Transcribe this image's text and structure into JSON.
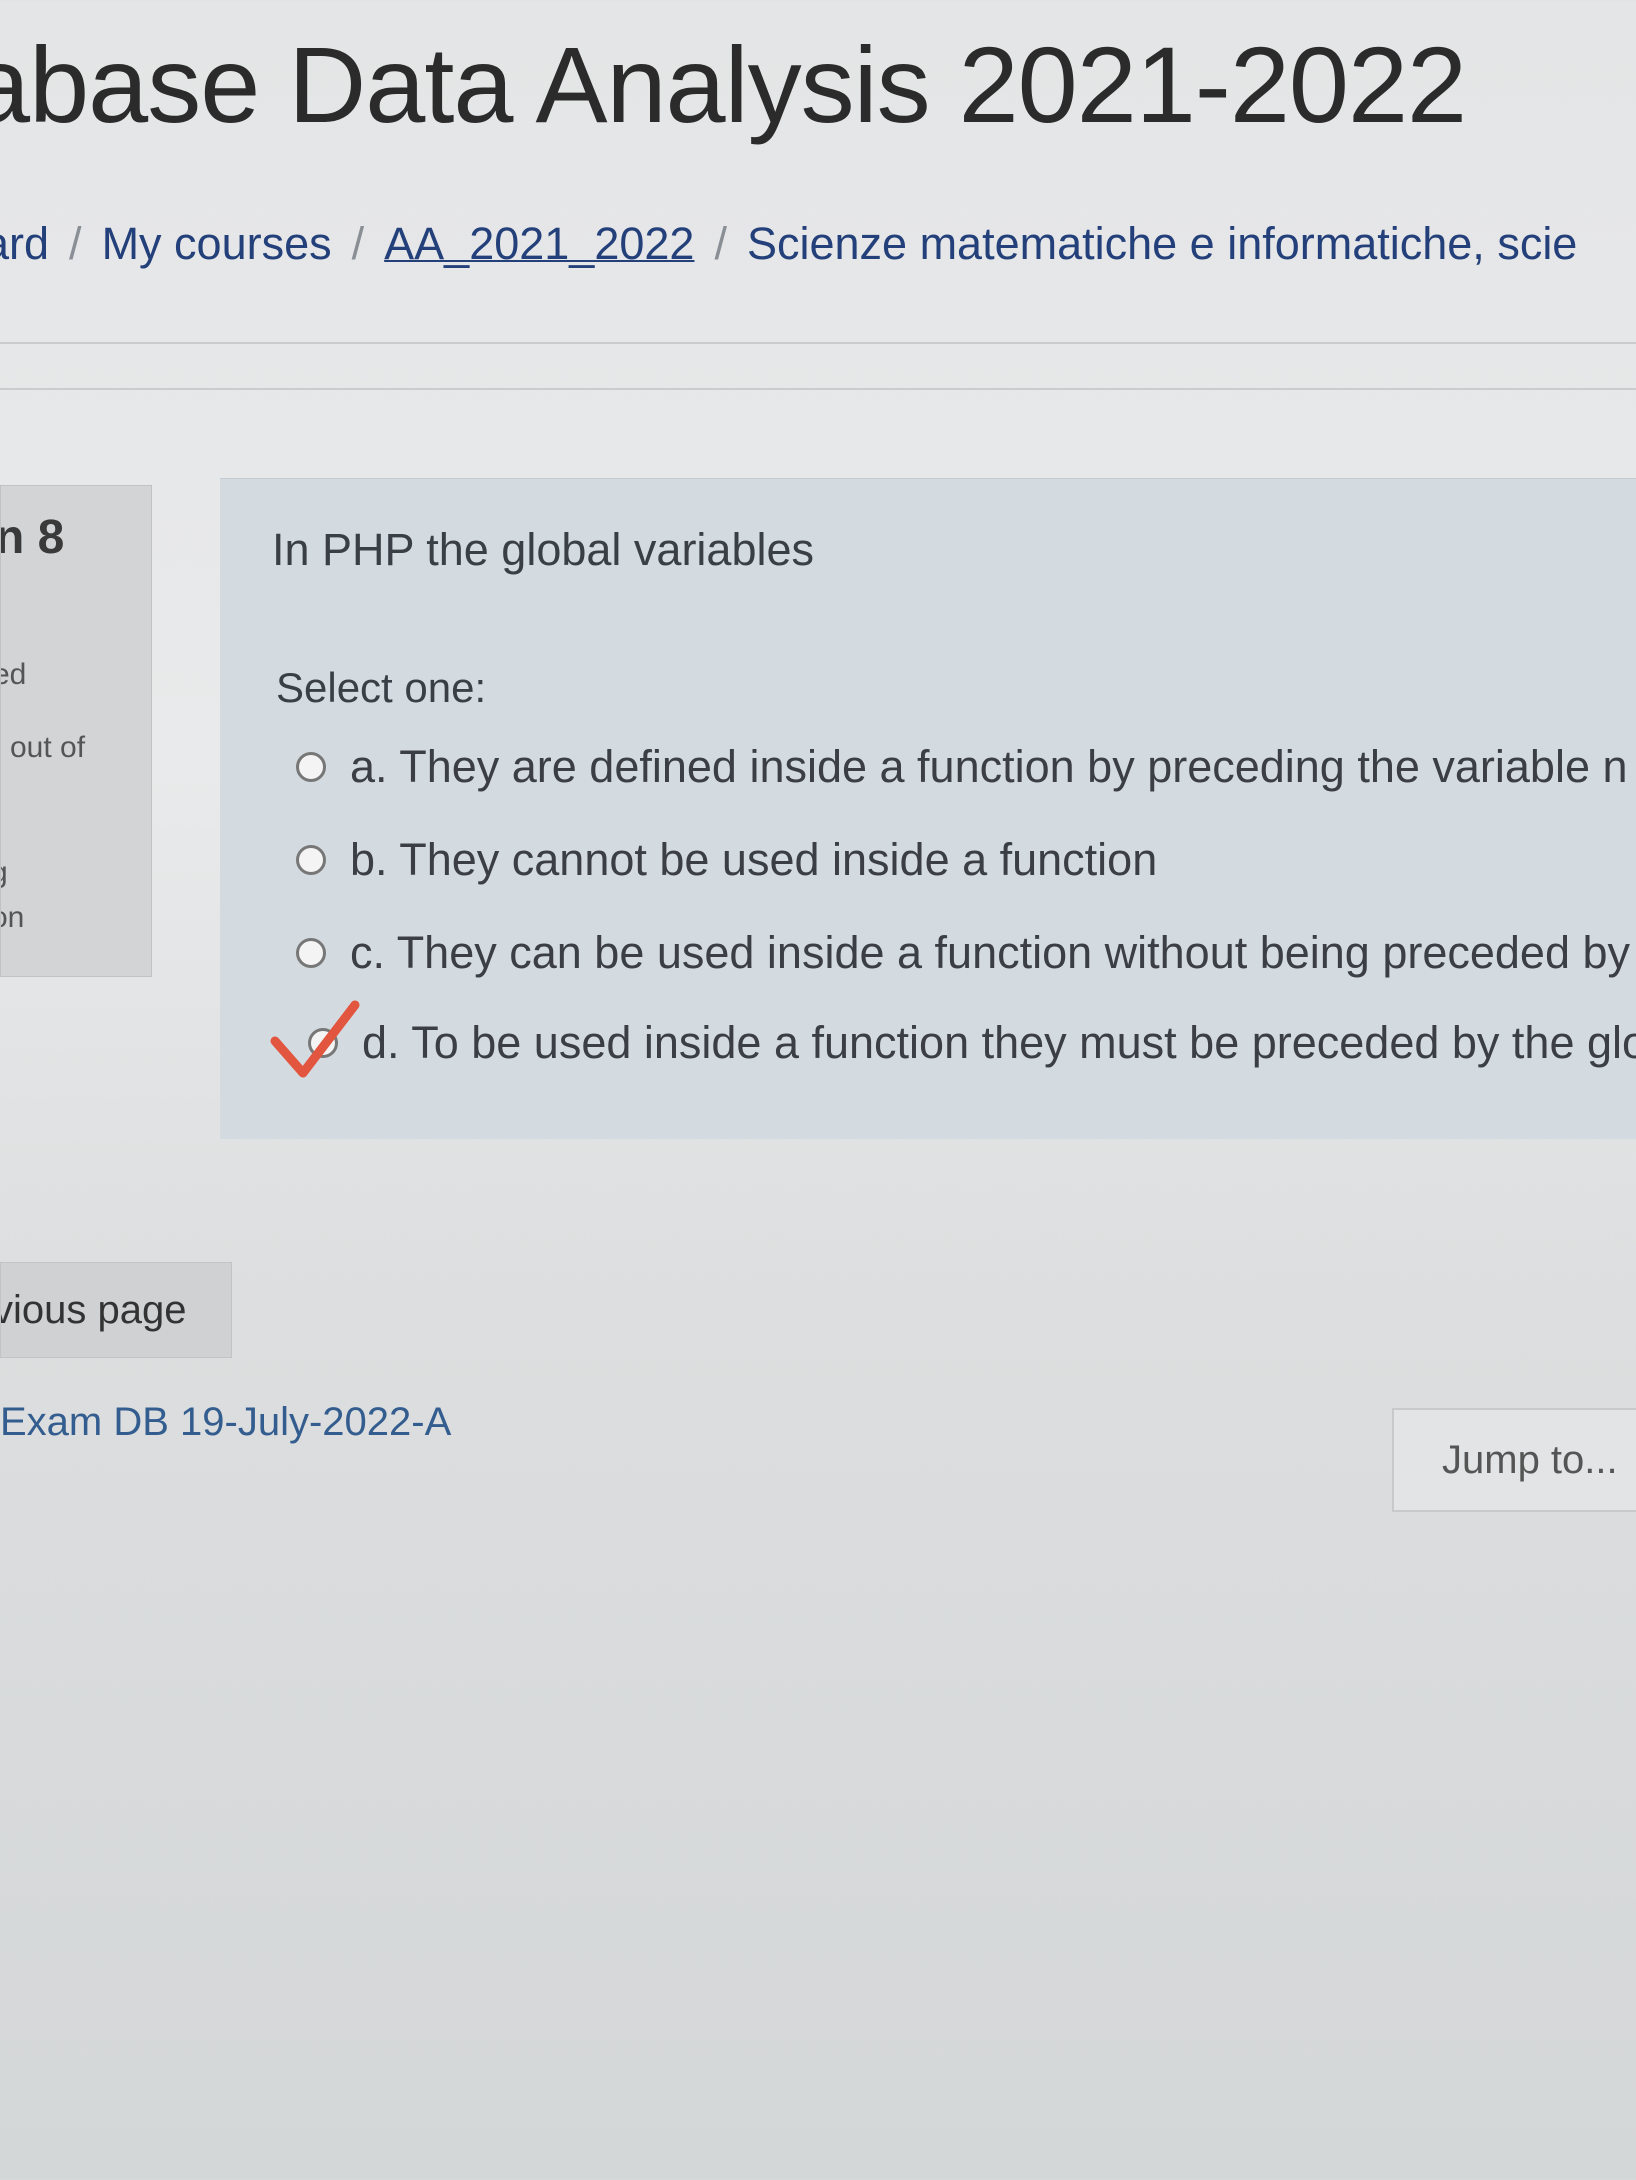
{
  "page": {
    "title": "abase Data Analysis 2021-2022"
  },
  "breadcrumb": {
    "items": [
      "ard",
      "My courses",
      "AA_2021_2022",
      "Scienze matematiche e informatiche, scie"
    ],
    "separator": "/"
  },
  "question_info": {
    "number": "n 8",
    "status": "ed",
    "marks": "l out of",
    "flag": "g",
    "edit": "on"
  },
  "question": {
    "text": "In PHP the global variables",
    "prompt": "Select one:",
    "answers": [
      {
        "label": "a. They are defined inside a function by preceding the variable n",
        "selected": false
      },
      {
        "label": "b. They cannot be used inside a function",
        "selected": false
      },
      {
        "label": "c. They can be used inside a function without being preceded by",
        "selected": false
      },
      {
        "label": "d. To be used inside a function they must be preceded by the glob",
        "selected": true
      }
    ],
    "check_mark_color": "#e2553f"
  },
  "navigation": {
    "previous_label": "vious page",
    "activity_link": "Exam DB 19-July-2022-A",
    "jump_placeholder": "Jump to..."
  }
}
